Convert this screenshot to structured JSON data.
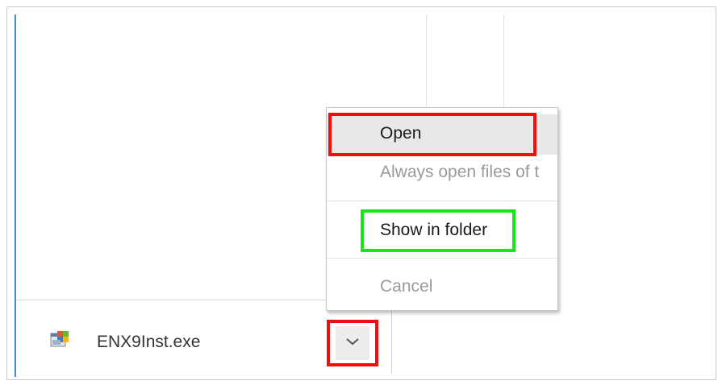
{
  "download": {
    "file_name": "ENX9Inst.exe",
    "icon": "installer-exe-icon",
    "menu_toggle_icon": "chevron-down-icon"
  },
  "context_menu": {
    "items": [
      {
        "label": "Open",
        "enabled": true
      },
      {
        "label": "Always open files of t",
        "enabled": false
      },
      {
        "label": "Show in folder",
        "enabled": true
      },
      {
        "label": "Cancel",
        "enabled": false
      }
    ]
  },
  "highlights": {
    "open": "#f20c0c",
    "show_in_folder": "#14e60f",
    "chevron_button": "#f20c0c"
  }
}
